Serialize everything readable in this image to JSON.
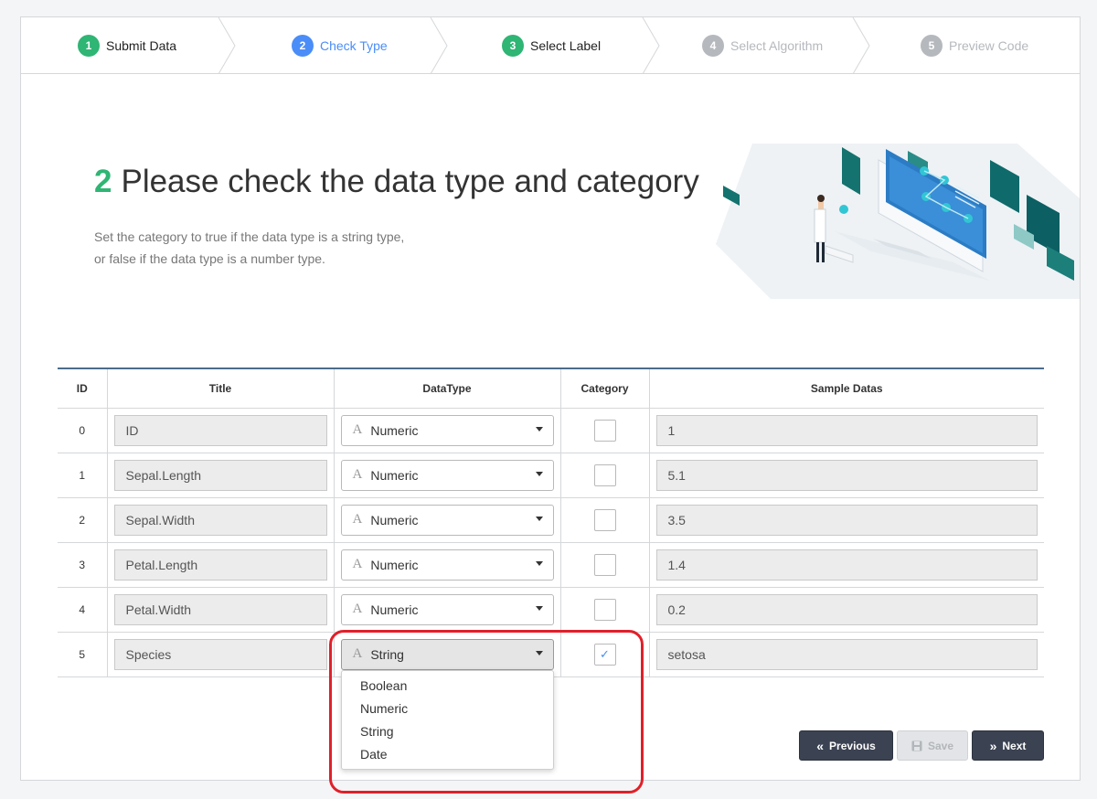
{
  "stepper": [
    {
      "num": "1",
      "label": "Submit Data",
      "state": "done"
    },
    {
      "num": "2",
      "label": "Check Type",
      "state": "active"
    },
    {
      "num": "3",
      "label": "Select Label",
      "state": "done"
    },
    {
      "num": "4",
      "label": "Select Algorithm",
      "state": "todo"
    },
    {
      "num": "5",
      "label": "Preview Code",
      "state": "todo"
    }
  ],
  "header": {
    "number": "2",
    "title": "Please check the data type and category",
    "desc_line1": "Set the category to true if the data type is a string type,",
    "desc_line2": "or false if the data type is a number type."
  },
  "table": {
    "columns": [
      "ID",
      "Title",
      "DataType",
      "Category",
      "Sample Datas"
    ],
    "rows": [
      {
        "id": "0",
        "title": "ID",
        "type": "Numeric",
        "category": false,
        "sample": "1"
      },
      {
        "id": "1",
        "title": "Sepal.Length",
        "type": "Numeric",
        "category": false,
        "sample": "5.1"
      },
      {
        "id": "2",
        "title": "Sepal.Width",
        "type": "Numeric",
        "category": false,
        "sample": "3.5"
      },
      {
        "id": "3",
        "title": "Petal.Length",
        "type": "Numeric",
        "category": false,
        "sample": "1.4"
      },
      {
        "id": "4",
        "title": "Petal.Width",
        "type": "Numeric",
        "category": false,
        "sample": "0.2"
      },
      {
        "id": "5",
        "title": "Species",
        "type": "String",
        "category": true,
        "sample": "setosa"
      }
    ],
    "type_icon": "A",
    "check_mark": "✓"
  },
  "dropdown": {
    "options": [
      "Boolean",
      "Numeric",
      "String",
      "Date"
    ]
  },
  "buttons": {
    "previous": "Previous",
    "save": "Save",
    "next": "Next"
  },
  "colors": {
    "done": "#2fb574",
    "active": "#4b8df8",
    "todo": "#b5b8bd",
    "highlight": "#e0202a"
  }
}
